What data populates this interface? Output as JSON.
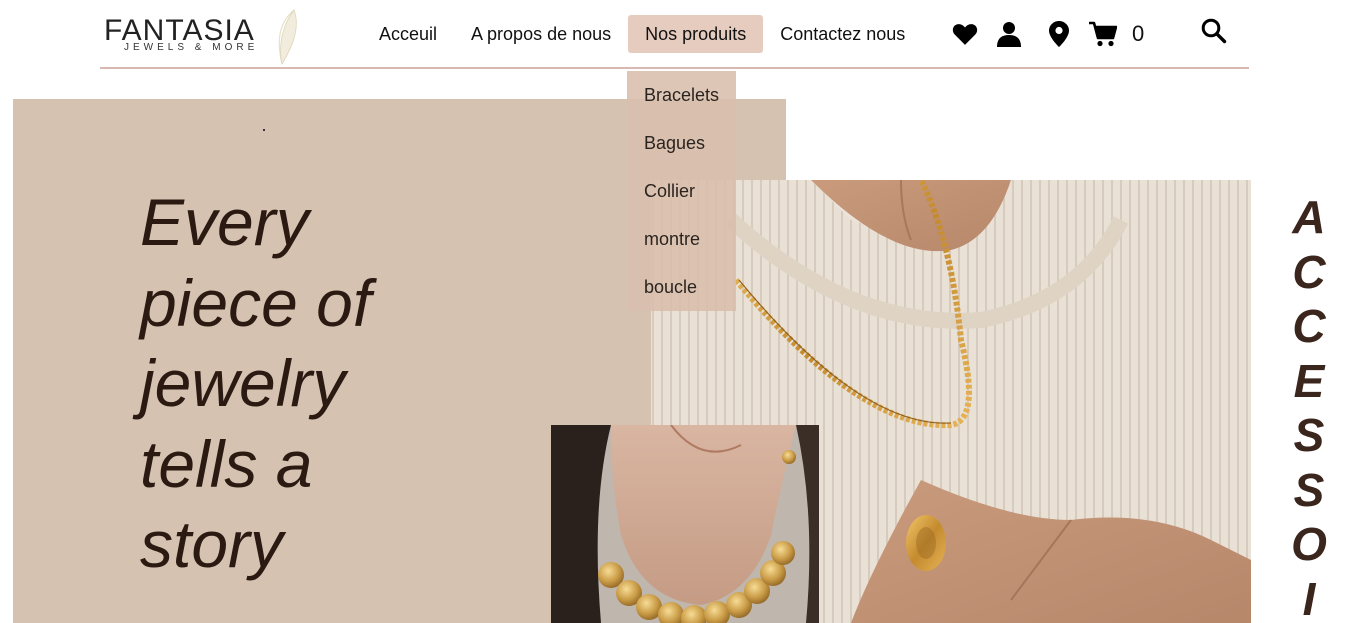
{
  "brand": {
    "name": "FANTASIA",
    "tagline": "JEWELS & MORE"
  },
  "nav": {
    "items": [
      {
        "label": "Acceuil",
        "active": false
      },
      {
        "label": "A propos de nous",
        "active": false
      },
      {
        "label": "Nos produits",
        "active": true
      },
      {
        "label": "Contactez nous",
        "active": false
      }
    ]
  },
  "icons": {
    "wishlist": "heart-icon",
    "account": "user-icon",
    "location": "map-pin-icon",
    "cart": "cart-icon",
    "search": "search-icon"
  },
  "cart": {
    "count": "0"
  },
  "dropdown": {
    "items": [
      "Bracelets",
      "Bagues",
      "Collier",
      "montre",
      "boucle"
    ]
  },
  "hero": {
    "lines": [
      "Every",
      "piece of",
      "jewelry",
      "tells a",
      "story"
    ]
  },
  "side_word": {
    "letters": [
      "A",
      "C",
      "C",
      "E",
      "S",
      "S",
      "O",
      "I"
    ]
  },
  "colors": {
    "hero_bg": "#d6c2b1",
    "active_nav": "#e6ccbe",
    "dropdown_bg": "#dabeac",
    "text_dark": "#2b1a12",
    "side_word": "#3b261d",
    "header_line": "#d8b8b0"
  }
}
